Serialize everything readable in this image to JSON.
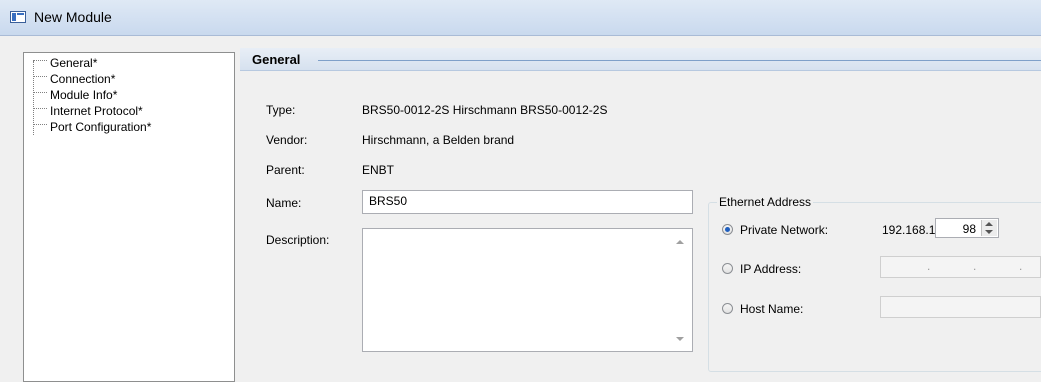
{
  "window": {
    "title": "New Module"
  },
  "tree": {
    "items": [
      {
        "label": "General*"
      },
      {
        "label": "Connection*"
      },
      {
        "label": "Module Info*"
      },
      {
        "label": "Internet Protocol*"
      },
      {
        "label": "Port Configuration*"
      }
    ]
  },
  "general": {
    "header": "General",
    "type_label": "Type:",
    "type_value": "BRS50-0012-2S Hirschmann BRS50-0012-2S",
    "vendor_label": "Vendor:",
    "vendor_value": "Hirschmann, a Belden brand",
    "parent_label": "Parent:",
    "parent_value": "ENBT",
    "name_label": "Name:",
    "name_value": "BRS50",
    "description_label": "Description:",
    "description_value": ""
  },
  "ethernet": {
    "group_title": "Ethernet Address",
    "private_label": "Private Network:",
    "private_prefix": "192.168.1.",
    "private_host": "98",
    "ip_label": "IP Address:",
    "ip_dots": [
      ".",
      ".",
      "."
    ],
    "host_label": "Host Name:",
    "host_value": "",
    "selected": "private"
  },
  "icons": {
    "app": "module-window-icon",
    "spin": "spinner-arrows-icon"
  }
}
